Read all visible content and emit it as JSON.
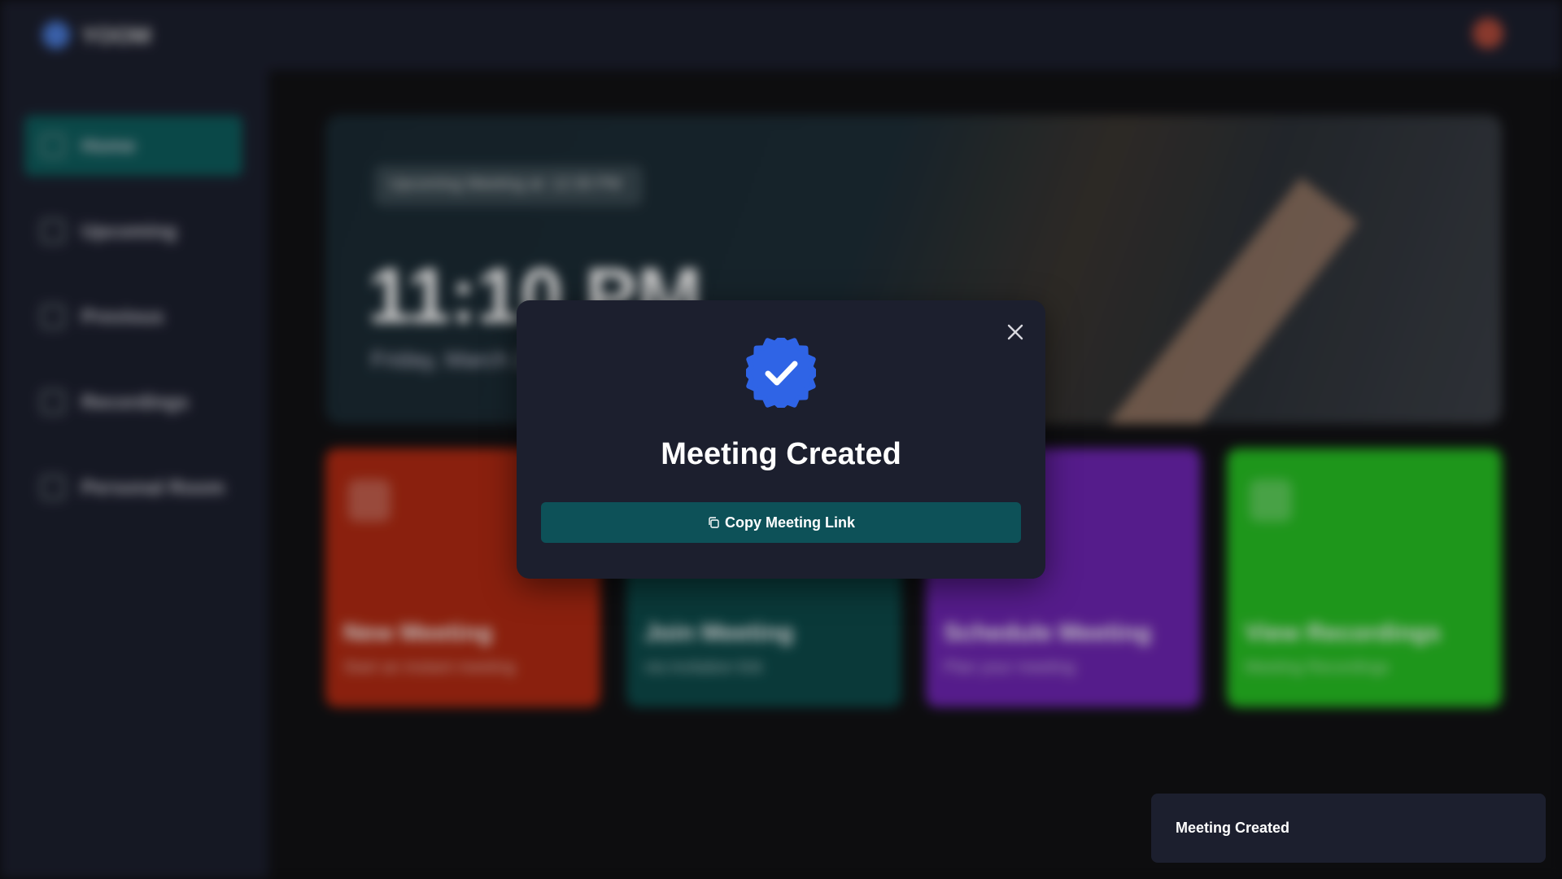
{
  "app": {
    "logo_text": "YOOM",
    "sidebar": {
      "items": [
        {
          "label": "Home",
          "icon": "home-icon",
          "active": true
        },
        {
          "label": "Upcoming",
          "icon": "calendar-icon",
          "active": false
        },
        {
          "label": "Previous",
          "icon": "previous-icon",
          "active": false
        },
        {
          "label": "Recordings",
          "icon": "video-icon",
          "active": false
        },
        {
          "label": "Personal Room",
          "icon": "add-personal-icon",
          "active": false
        }
      ]
    },
    "hero": {
      "pill": "Upcoming Meeting at: 12:30 PM",
      "time": "11:10 PM",
      "date": "Friday, March 29"
    },
    "cards": [
      {
        "title": "New Meeting",
        "subtitle": "Start an instant meeting",
        "color": "#b12a12"
      },
      {
        "title": "Join Meeting",
        "subtitle": "via invitation link",
        "color": "#0d4a4a"
      },
      {
        "title": "Schedule Meeting",
        "subtitle": "Plan your meeting",
        "color": "#6e25b2"
      },
      {
        "title": "View Recordings",
        "subtitle": "Meeting Recordings",
        "color": "#27c023"
      }
    ]
  },
  "modal": {
    "title": "Meeting Created",
    "copy_button_label": "Copy Meeting Link",
    "icons": {
      "badge": "verified-check-icon",
      "close": "close-icon",
      "copy": "copy-icon"
    },
    "colors": {
      "badge": "#2f64e6",
      "button": "#0d5158",
      "background": "#1c1f2e"
    }
  },
  "toast": {
    "message": "Meeting Created"
  }
}
